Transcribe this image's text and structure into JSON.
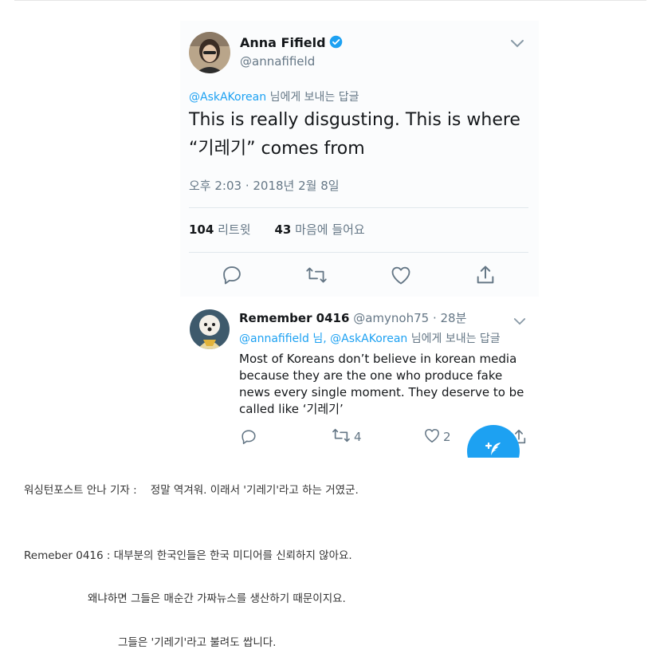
{
  "tweet": {
    "author_name": "Anna Fifield",
    "author_handle": "@annafifield",
    "reply_mention": "@AskAKorean",
    "reply_suffix": " 님에게 보내는 답글",
    "text": "This is really disgusting. This is where “기레기” comes from",
    "time": "오후 2:03 · 2018년 2월 8일",
    "retweets_count": "104",
    "retweets_label": "리트윗",
    "likes_count": "43",
    "likes_label": "마음에 들어요"
  },
  "reply": {
    "name": "Remember 0416",
    "handle_time": "@amynoh75 · 28분",
    "to_mentions": "@annafifield 님, @AskAKorean",
    "to_suffix": " 님에게 보내는 답글",
    "text": "Most of Koreans don’t believe in korean media because they are the one who produce fake news every single moment. They deserve to be called like ‘기레기’",
    "retweet_count": "4",
    "like_count": "2"
  },
  "captions": {
    "line1": "워싱턴포스트 안나 기자 :    정말 역겨워. 이래서 '기레기'라고 하는 거였군.",
    "line2": "Remeber 0416 : 대부분의 한국인들은 한국 미디어를 신뢰하지 않아요.",
    "line3": "왜냐하면 그들은 매순간 가짜뉴스를 생산하기 때문이지요.",
    "line4": "그들은 '기레기'라고 불려도 쌉니다."
  },
  "icons": {
    "verified": "verified-badge-icon",
    "menu": "chevron-down-icon",
    "reply": "reply-icon",
    "retweet": "retweet-icon",
    "like": "heart-icon",
    "share": "share-icon",
    "compose": "compose-tweet-icon"
  },
  "colors": {
    "link": "#1da1f2",
    "secondary_text": "#657786",
    "primary_text": "#14171a",
    "fab": "#1da1f2"
  }
}
